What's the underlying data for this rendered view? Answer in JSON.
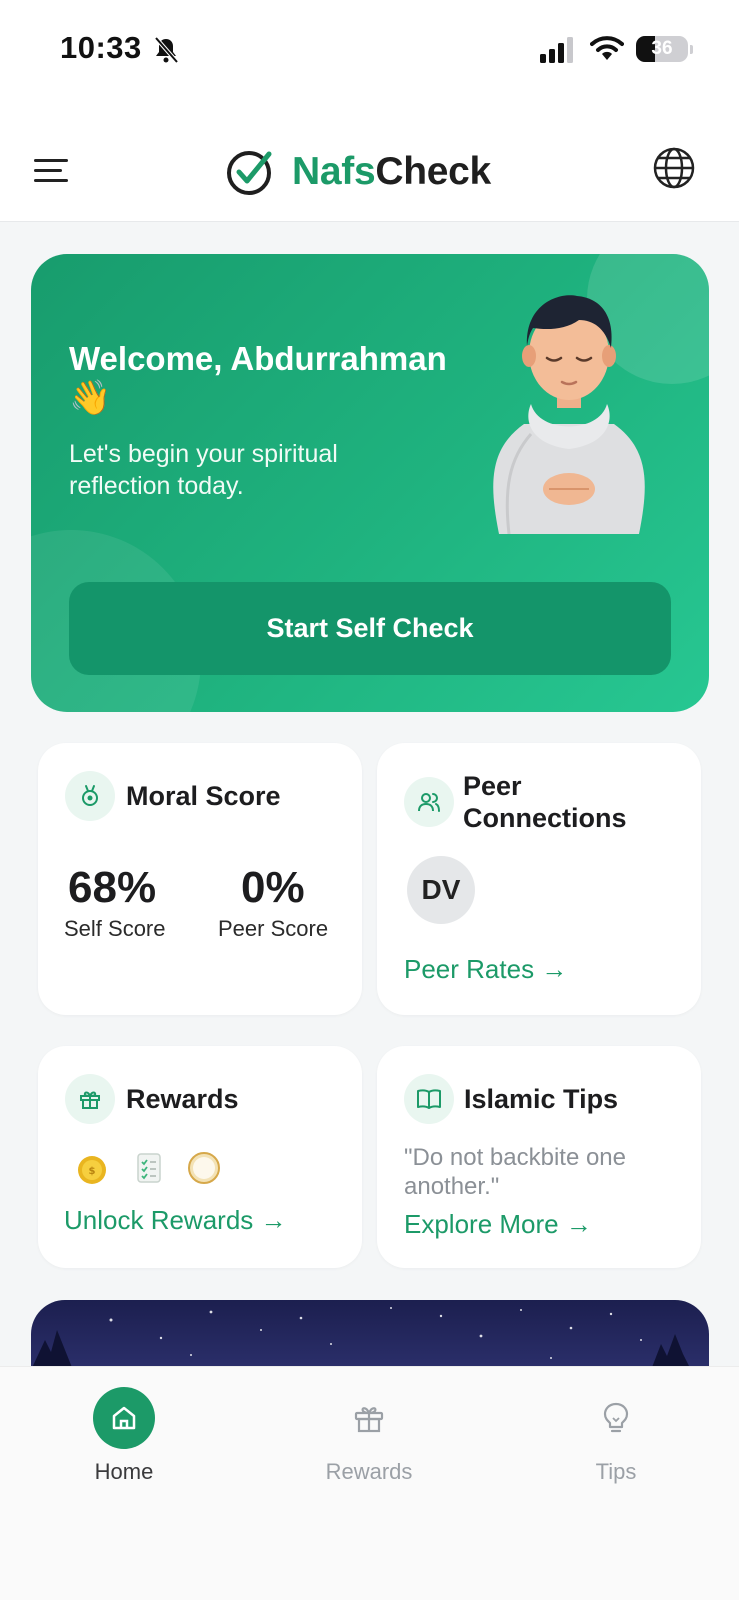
{
  "status_bar": {
    "time": "10:33",
    "battery": "36",
    "battery_level": 0.36
  },
  "header": {
    "logo_part1": "Nafs",
    "logo_part2": "Check",
    "brand_color": "#1c9a68"
  },
  "hero": {
    "title": "Welcome, Abdurrahman",
    "emoji": "👋",
    "subtitle": "Let's begin your spiritual reflection today.",
    "button_label": "Start Self Check"
  },
  "moral_score": {
    "title": "Moral Score",
    "self_value": "68%",
    "self_label": "Self Score",
    "peer_value": "0%",
    "peer_label": "Peer Score"
  },
  "peer_connections": {
    "title": "Peer Connections",
    "avatar_initials": "DV",
    "link_label": "Peer Rates →"
  },
  "rewards": {
    "title": "Rewards",
    "badges": [
      "coin-badge-icon",
      "checklist-badge-icon",
      "compass-badge-icon"
    ],
    "link_label": "Unlock Rewards →"
  },
  "islamic_tips": {
    "title": "Islamic Tips",
    "quote": "\"Do not backbite one another.\"",
    "link_label": "Explore More →"
  },
  "bottom_nav": {
    "items": [
      {
        "label": "Home",
        "icon": "home-icon",
        "active": true
      },
      {
        "label": "Rewards",
        "icon": "gift-icon",
        "active": false
      },
      {
        "label": "Tips",
        "icon": "lightbulb-icon",
        "active": false
      }
    ]
  }
}
